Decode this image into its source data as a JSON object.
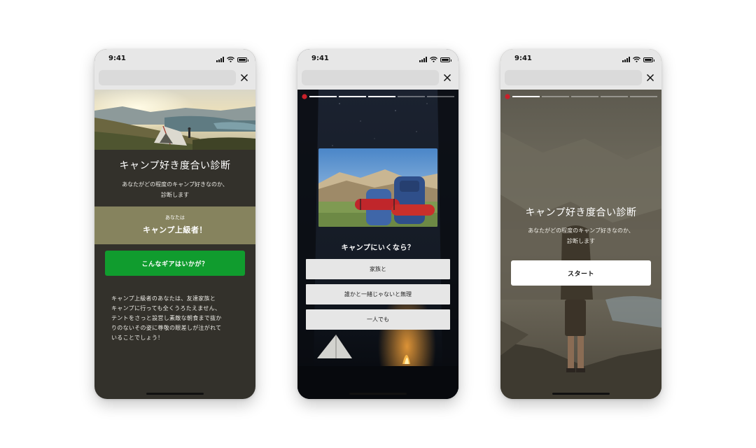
{
  "colors": {
    "phone1_bg": "#33312b",
    "result_band": "#86835e",
    "gear_button": "#109c2e",
    "answer_button": "#e6e6e6",
    "start_button": "#ffffff"
  },
  "status_bar": {
    "time": "9:41",
    "icons": [
      "signal-icon",
      "wifi-icon",
      "battery-icon"
    ]
  },
  "browser": {
    "close_icon": "close-icon"
  },
  "screen_result": {
    "title": "キャンプ好き度合い診断",
    "description_line1": "あなたがどの程度のキャンプ好きなのか、",
    "description_line2": "診断します",
    "result_label": "あなたは",
    "result_value": "キャンプ上級者！",
    "gear_button": "こんなギアはいかが？",
    "body_lines": [
      "キャンプ上級者のあなたは、友達家族と",
      "キャンプに行っても全くうろたえません、",
      "テントをさっと設営し素敵な朝食まで抜か",
      "りのないその姿に尊敬の眼差しが注がれて",
      "いることでしょう！"
    ]
  },
  "screen_question": {
    "progress_total": 5,
    "progress_done": 3,
    "question": "キャンプにいくなら？",
    "answers": [
      "家族と",
      "誰かと一緒じゃないと無理",
      "一人でも"
    ]
  },
  "screen_start": {
    "progress_total": 5,
    "progress_done": 1,
    "title": "キャンプ好き度合い診断",
    "description_line1": "あなたがどの程度のキャンプ好きなのか、",
    "description_line2": "診断します",
    "start_button": "スタート"
  }
}
